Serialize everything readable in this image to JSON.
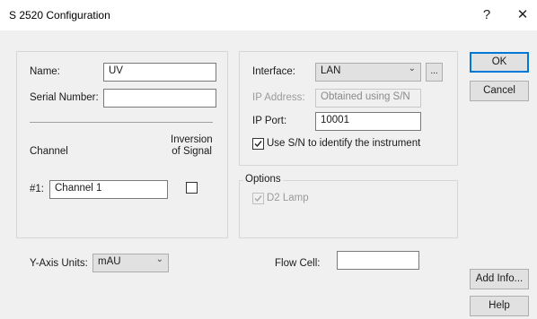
{
  "window": {
    "title": "S 2520 Configuration",
    "help_glyph": "?",
    "close_glyph": "✕"
  },
  "detector": {
    "name_label": "Name:",
    "name_value": "UV",
    "serial_label": "Serial Number:",
    "serial_value": "",
    "channel_header": "Channel",
    "inversion_header_line1": "Inversion",
    "inversion_header_line2": "of Signal",
    "channel1_label": "#1:",
    "channel1_value": "Channel 1",
    "channel1_inverted": false
  },
  "connection": {
    "interface_label": "Interface:",
    "interface_value": "LAN",
    "browse_label": "...",
    "ip_address_label": "IP Address:",
    "ip_address_value": "Obtained using S/N",
    "ip_port_label": "IP Port:",
    "ip_port_value": "10001",
    "use_sn_label": "Use S/N to identify the instrument",
    "use_sn_checked": true
  },
  "options": {
    "legend": "Options",
    "d2_lamp_label": "D2 Lamp",
    "d2_lamp_checked": true,
    "d2_lamp_enabled": false
  },
  "bottom": {
    "y_axis_label": "Y-Axis Units:",
    "y_axis_value": "mAU",
    "flow_cell_label": "Flow Cell:",
    "flow_cell_value": ""
  },
  "buttons": {
    "ok": "OK",
    "cancel": "Cancel",
    "add_info": "Add Info...",
    "help": "Help"
  },
  "colors": {
    "accent": "#0078d7",
    "dialog_bg": "#f0f0f0",
    "disabled_text": "#9a9a9a"
  }
}
